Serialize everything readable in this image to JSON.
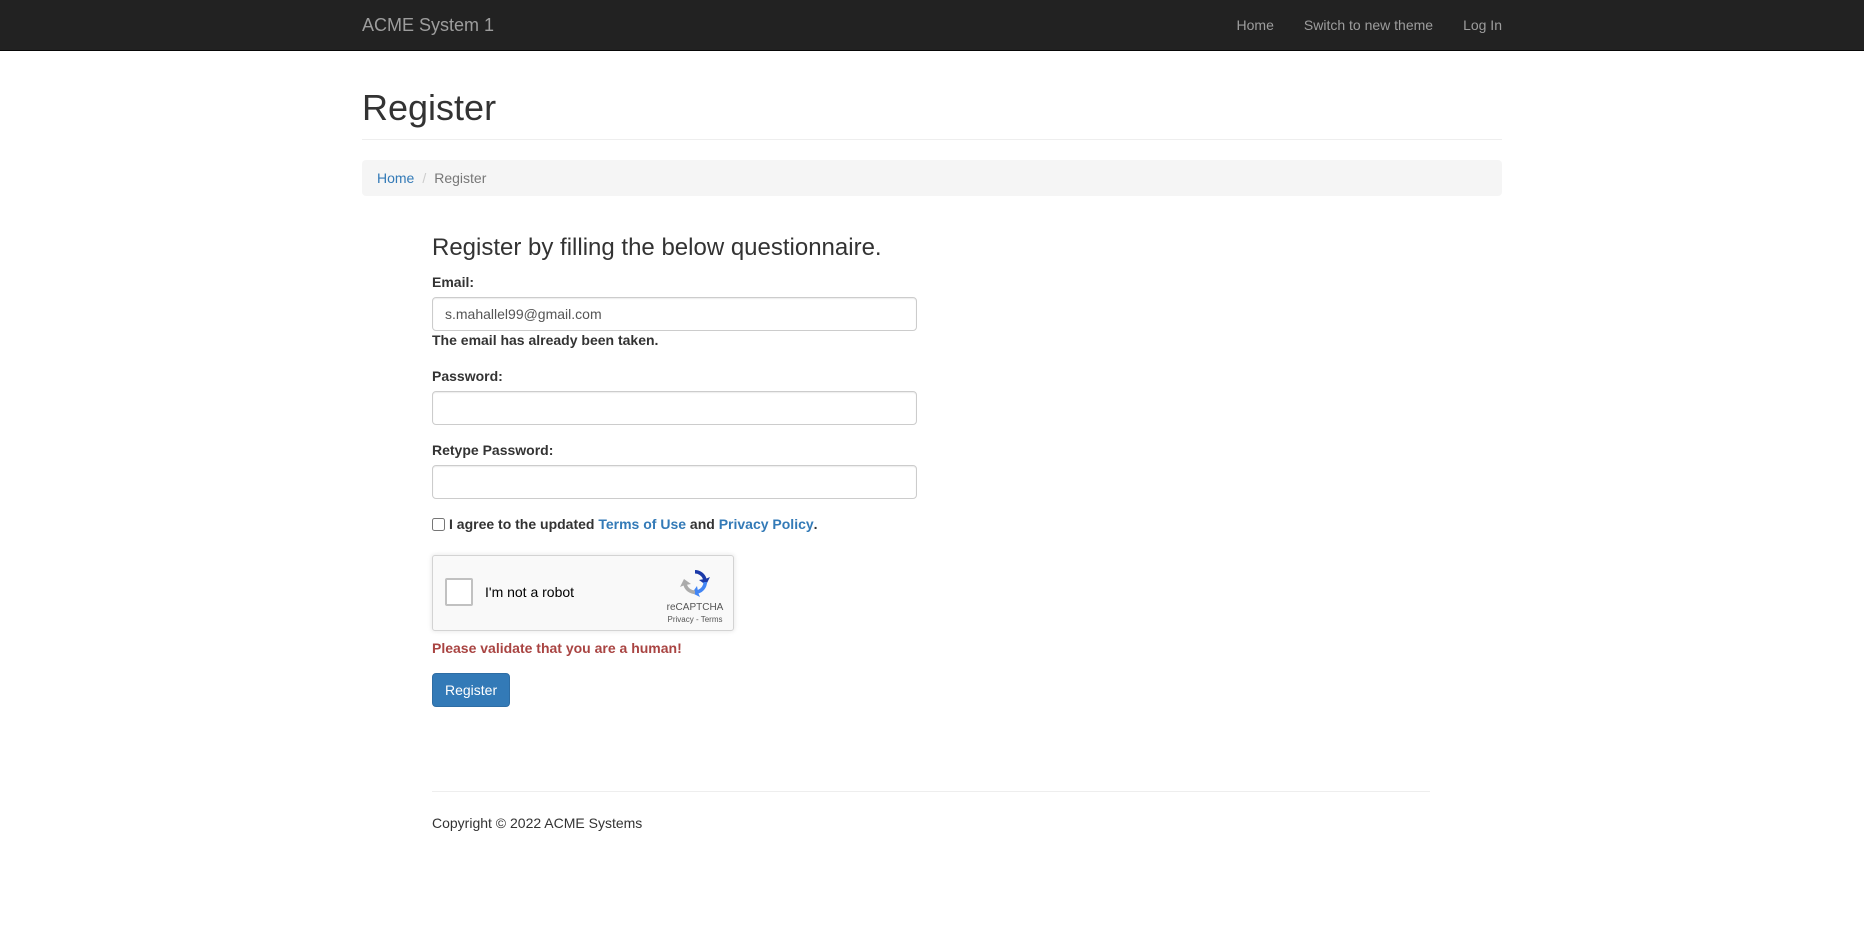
{
  "navbar": {
    "brand": "ACME System 1",
    "links": [
      "Home",
      "Switch to new theme",
      "Log In"
    ]
  },
  "page": {
    "title": "Register"
  },
  "breadcrumb": {
    "home": "Home",
    "separator": "/",
    "current": "Register"
  },
  "form": {
    "heading": "Register by filling the below questionnaire.",
    "email_label": "Email:",
    "email_value": "s.mahallel99@gmail.com",
    "email_error": "The email has already been taken.",
    "password_label": "Password:",
    "password_value": "",
    "retype_label": "Retype Password:",
    "retype_value": "",
    "agree_prefix": "I agree to the updated",
    "terms_link": "Terms of Use",
    "agree_and": "and",
    "privacy_link": "Privacy Policy",
    "agree_suffix": ".",
    "agree_checked": false,
    "captcha_error": "Please validate that you are a human!",
    "submit_label": "Register"
  },
  "recaptcha": {
    "label": "I'm not a robot",
    "brand": "reCAPTCHA",
    "privacy": "Privacy",
    "separator": " - ",
    "terms": "Terms"
  },
  "footer": {
    "copyright": "Copyright © 2022 ACME Systems"
  },
  "colors": {
    "navbar_bg": "#222222",
    "link": "#337ab7",
    "error": "#a94442",
    "primary_button": "#337ab7"
  }
}
